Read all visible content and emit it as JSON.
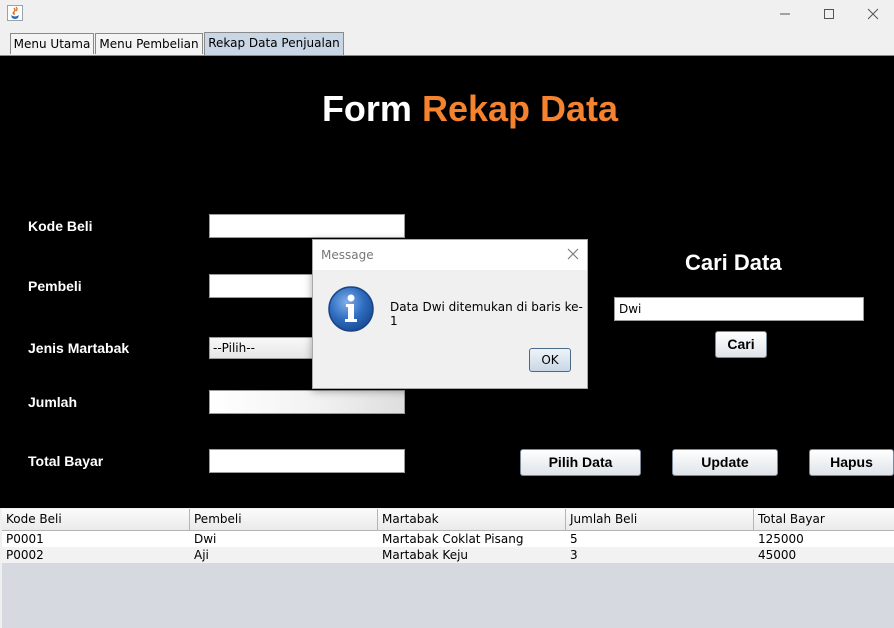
{
  "window": {
    "icon": "java-cup-icon"
  },
  "tabs": [
    {
      "label": "Menu Utama",
      "active": false
    },
    {
      "label": "Menu Pembelian",
      "active": false
    },
    {
      "label": "Rekap Data Penjualan",
      "active": true
    }
  ],
  "form": {
    "title_part1": "Form",
    "title_part2": "Rekap Data",
    "labels": {
      "kode_beli": "Kode Beli",
      "pembeli": "Pembeli",
      "jenis_martabak": "Jenis Martabak",
      "jumlah": "Jumlah",
      "total_bayar": "Total Bayar"
    },
    "values": {
      "kode_beli": "",
      "pembeli": "",
      "jumlah": "",
      "total_bayar": ""
    },
    "jenis_martabak_selected": "--Pilih--"
  },
  "search": {
    "title": "Cari Data",
    "value": "Dwi",
    "button": "Cari"
  },
  "actions": {
    "pilih_data": "Pilih Data",
    "update": "Update",
    "hapus": "Hapus"
  },
  "table": {
    "columns": [
      "Kode Beli",
      "Pembeli",
      "Martabak",
      "Jumlah Beli",
      "Total Bayar"
    ],
    "rows": [
      [
        "P0001",
        "Dwi",
        "Martabak Coklat Pisang",
        "5",
        "125000"
      ],
      [
        "P0002",
        "Aji",
        "Martabak Keju",
        "3",
        "45000"
      ]
    ]
  },
  "dialog": {
    "title": "Message",
    "message": "Data Dwi ditemukan di baris ke-1",
    "ok": "OK",
    "icon": "info-icon"
  },
  "colors": {
    "accent": "#f4822e",
    "panel_bg": "#000000",
    "active_tab": "#c8d6e6"
  }
}
